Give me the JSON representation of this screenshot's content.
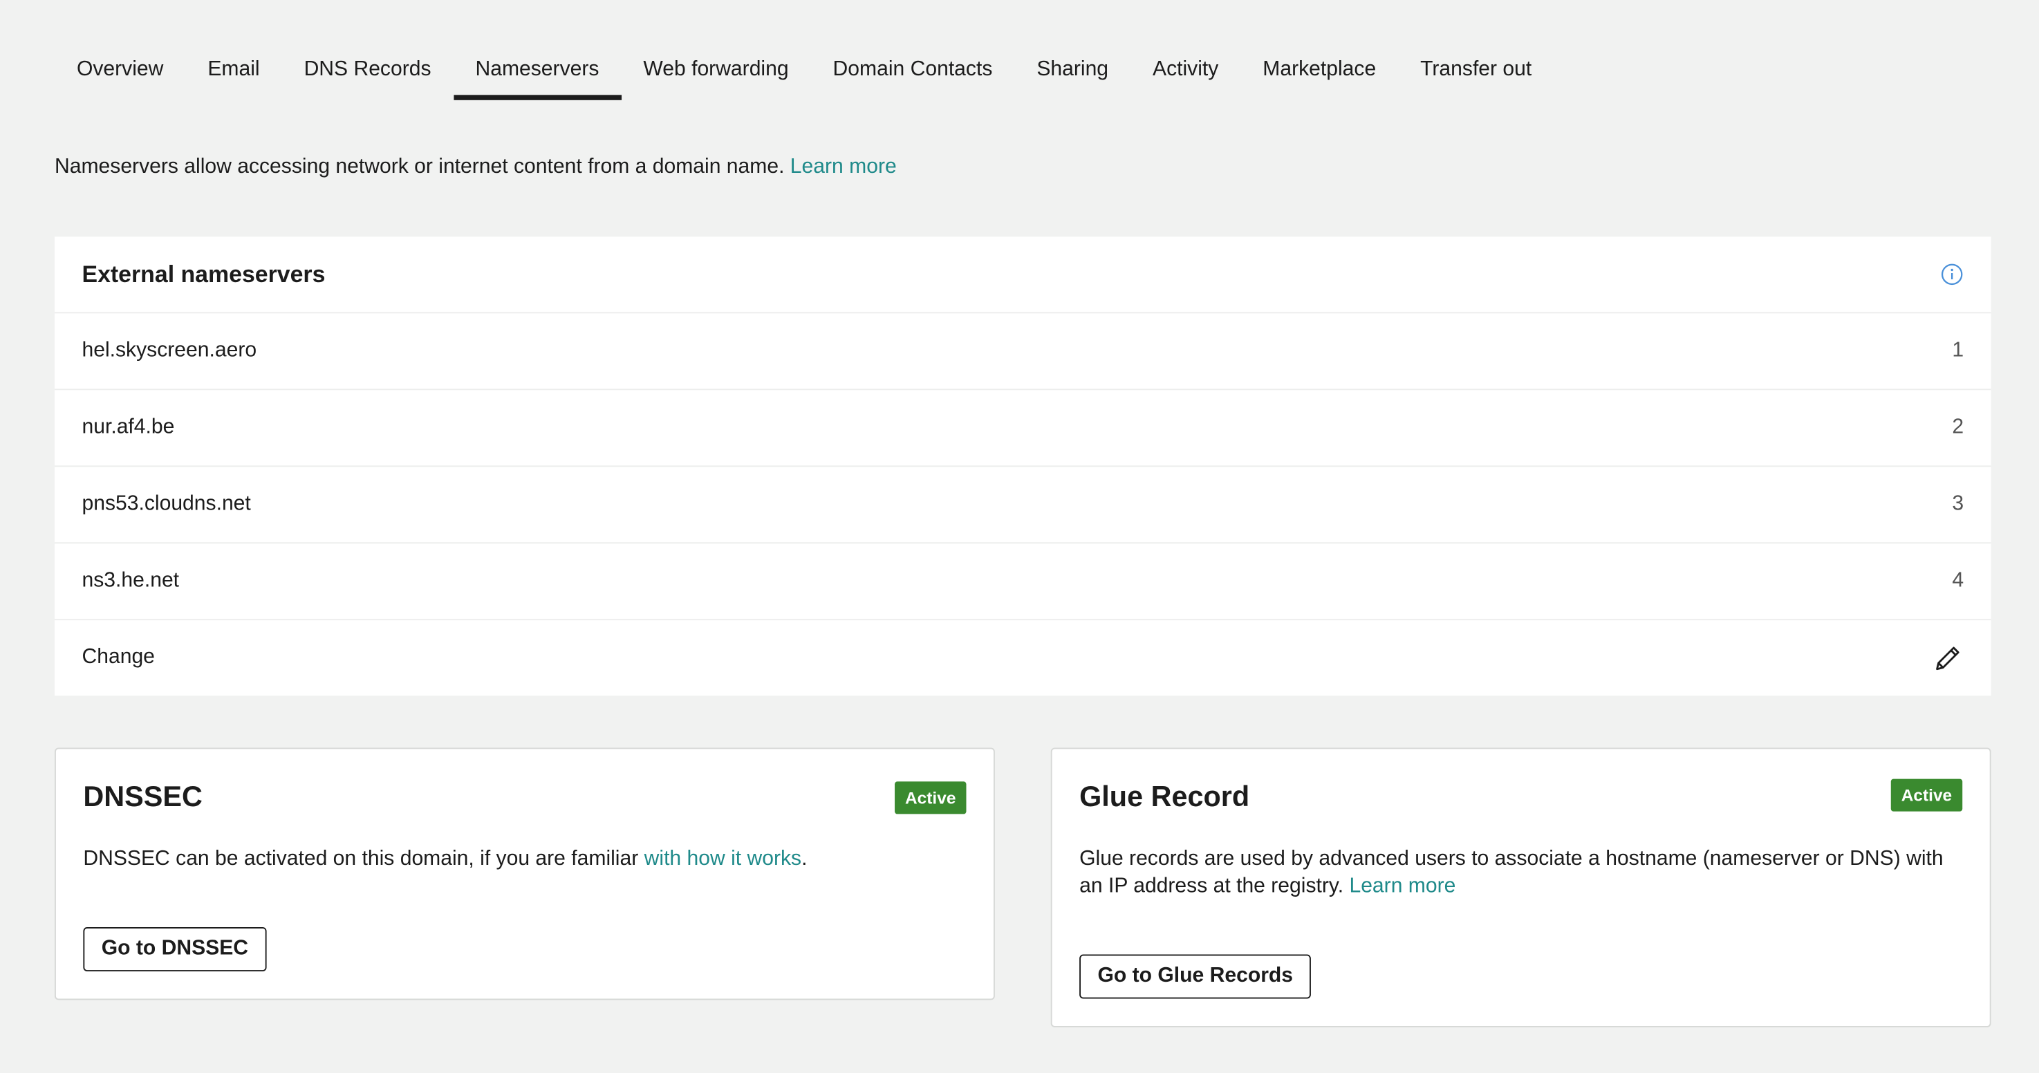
{
  "tabs": [
    {
      "label": "Overview",
      "active": false
    },
    {
      "label": "Email",
      "active": false
    },
    {
      "label": "DNS Records",
      "active": false
    },
    {
      "label": "Nameservers",
      "active": true
    },
    {
      "label": "Web forwarding",
      "active": false
    },
    {
      "label": "Domain Contacts",
      "active": false
    },
    {
      "label": "Sharing",
      "active": false
    },
    {
      "label": "Activity",
      "active": false
    },
    {
      "label": "Marketplace",
      "active": false
    },
    {
      "label": "Transfer out",
      "active": false
    }
  ],
  "intro": {
    "text": "Nameservers allow accessing network or internet content from a domain name.",
    "link": "Learn more"
  },
  "external_nameservers": {
    "title": "External nameservers",
    "icon": "info-icon",
    "rows": [
      {
        "host": "hel.skyscreen.aero",
        "index": "1"
      },
      {
        "host": "nur.af4.be",
        "index": "2"
      },
      {
        "host": "pns53.cloudns.net",
        "index": "3"
      },
      {
        "host": "ns3.he.net",
        "index": "4"
      }
    ],
    "change_label": "Change",
    "change_icon": "pencil-icon"
  },
  "dnssec": {
    "title": "DNSSEC",
    "badge": "Active",
    "text": "DNSSEC can be activated on this domain, if you are familiar",
    "link": "with how it works",
    "text_end": ".",
    "button": "Go to DNSSEC"
  },
  "glue": {
    "title": "Glue Record",
    "badge": "Active",
    "text": "Glue records are used by advanced users to associate a hostname (nameserver or DNS) with an IP address at the registry.",
    "link": "Learn more",
    "button": "Go to Glue Records"
  },
  "colors": {
    "accent_link": "#1f8a8a",
    "badge_green": "#3a8a2f",
    "background": "#f1f2f1",
    "info_blue": "#4a90d9"
  }
}
